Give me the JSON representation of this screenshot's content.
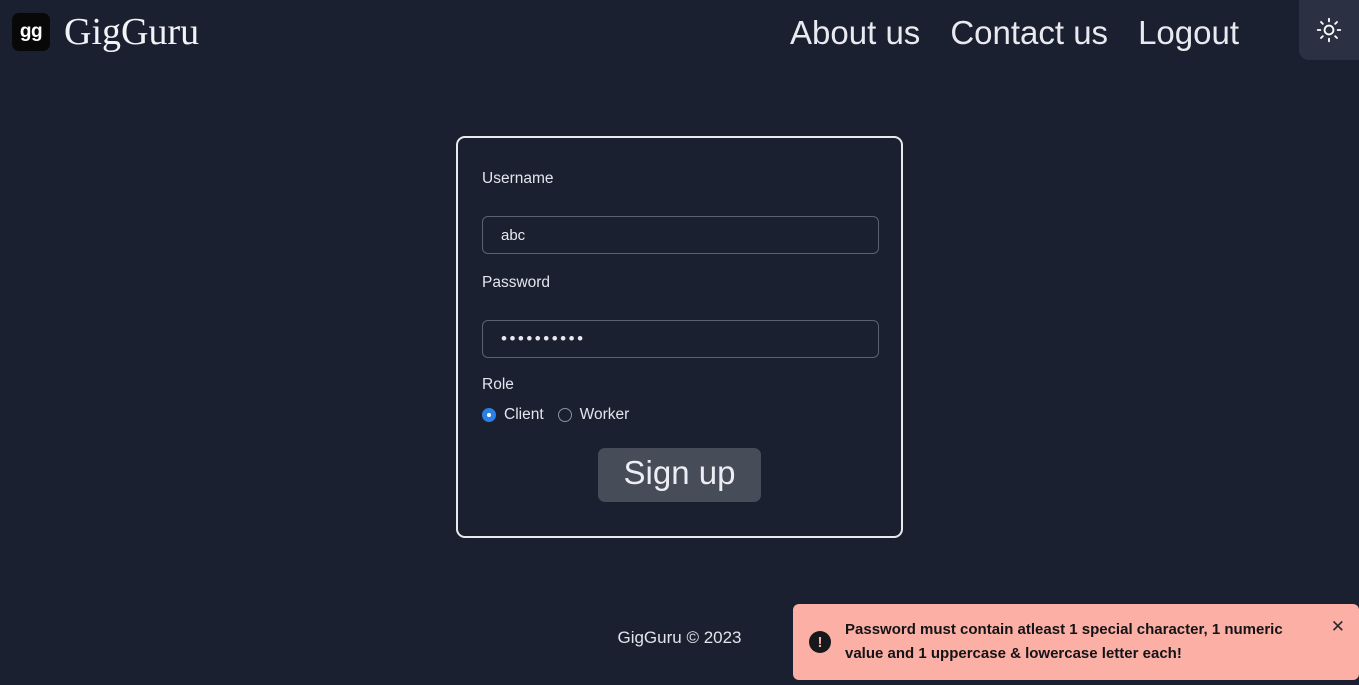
{
  "header": {
    "logo_text": "gg",
    "brand_name": "GigGuru",
    "nav": [
      {
        "label": "About us",
        "name": "nav-link-about-us"
      },
      {
        "label": "Contact us",
        "name": "nav-link-contact-us"
      },
      {
        "label": "Logout",
        "name": "nav-link-logout"
      }
    ],
    "theme_toggle_icon": "sun-icon"
  },
  "form": {
    "username_label": "Username",
    "username_value": "abc",
    "username_placeholder": "",
    "password_label": "Password",
    "password_value": "••••••••••",
    "password_placeholder": "",
    "role_label": "Role",
    "roles": [
      {
        "label": "Client",
        "selected": true
      },
      {
        "label": "Worker",
        "selected": false
      }
    ],
    "submit_label": "Sign up"
  },
  "footer": {
    "text": "GigGuru © 2023"
  },
  "toast": {
    "icon": "exclamation-circle-icon",
    "icon_glyph": "!",
    "message": "Password must contain atleast 1 special character, 1 numeric value and 1 uppercase & lowercase letter each!",
    "close_glyph": "✕",
    "background_color": "#fcafa4",
    "text_color": "#131417"
  },
  "colors": {
    "page_background": "#1b2030",
    "card_border": "#e9eaec",
    "accent_radio": "#2b80e6",
    "button_background": "#474c59",
    "toggle_background": "#2b3143"
  }
}
